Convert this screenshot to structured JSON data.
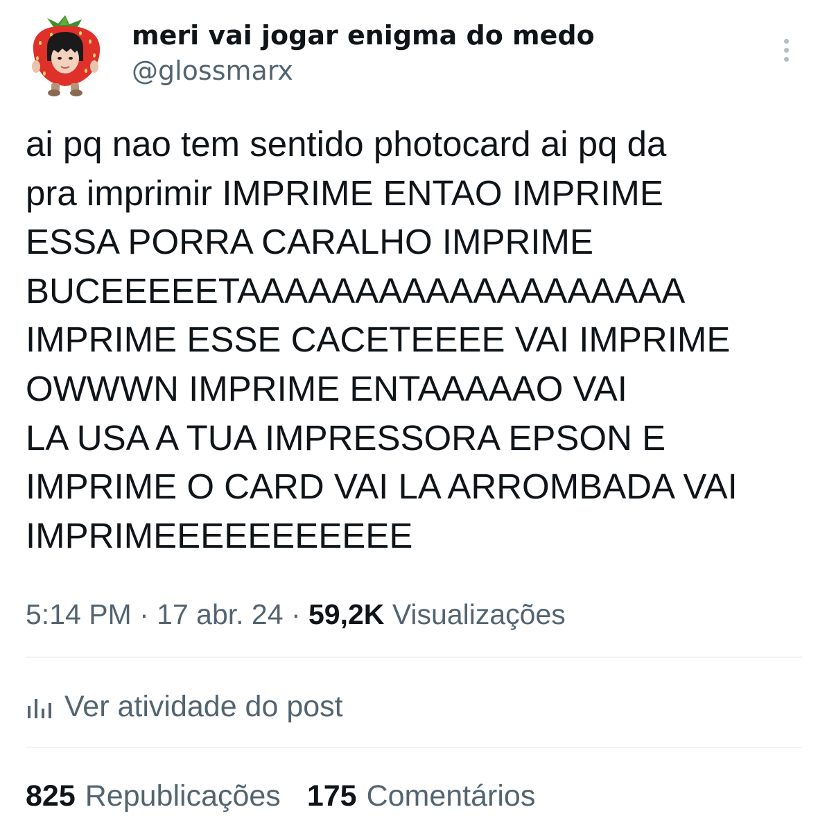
{
  "author": {
    "display_name": "meri vai jogar enigma do medo",
    "handle": "@glossmarx",
    "avatar_icon": "strawberry-costume-avatar"
  },
  "more_icon": "more-vertical-icon",
  "body_lines": [
    "ai pq nao tem sentido photocard ai pq da",
    "pra imprimir IMPRIME ENTAO IMPRIME",
    "ESSA PORRA CARALHO IMPRIME",
    "BUCEEEEETAAAAAAAAAAAAAAAAAAA",
    "IMPRIME ESSE CACETEEEE VAI IMPRIME",
    "OWWWN IMPRIME ENTAAAAAO VAI",
    "LA USA A TUA IMPRESSORA EPSON E",
    "IMPRIME O CARD VAI LA ARROMBADA VAI",
    "IMPRIMEEEEEEEEEEE"
  ],
  "meta": {
    "time": "5:14 PM",
    "date": "17 abr. 24",
    "separator": "·",
    "views_count": "59,2K",
    "views_label": "Visualizações"
  },
  "activity": {
    "icon": "analytics-bars-icon",
    "label": "Ver atividade do post"
  },
  "stats": {
    "reposts_count": "825",
    "reposts_label": "Republicações",
    "comments_count": "175",
    "comments_label": "Comentários"
  },
  "colors": {
    "text_primary": "#0f1419",
    "text_secondary": "#536471",
    "divider": "#eff3f4"
  }
}
